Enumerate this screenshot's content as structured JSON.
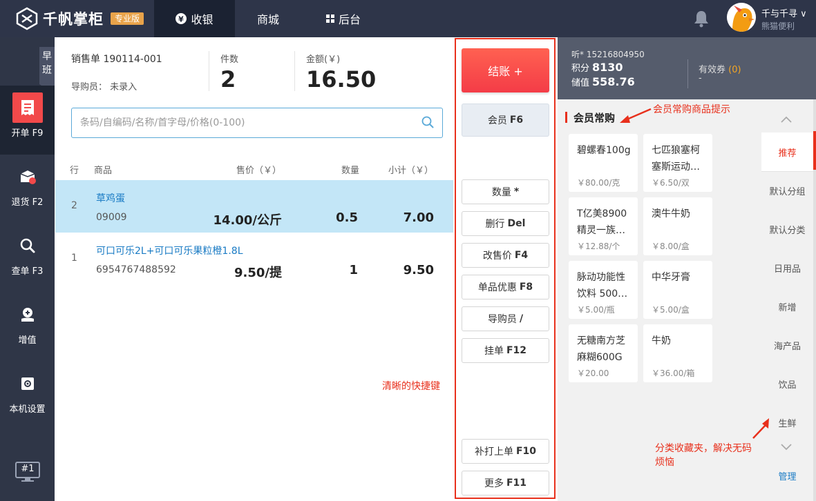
{
  "app": {
    "logo_text": "千帆掌柜",
    "edition": "专业版",
    "nav": [
      {
        "label": "收银",
        "active": true,
        "icon": "yen-circle-icon"
      },
      {
        "label": "商城",
        "active": false
      },
      {
        "label": "后台",
        "active": false,
        "icon": "grid-icon"
      }
    ],
    "user": {
      "name": "千与千寻",
      "store": "熊猫便利"
    }
  },
  "sidebar": {
    "shift": "早班",
    "items": [
      {
        "label": "开单 F9",
        "icon": "order-icon",
        "active": true
      },
      {
        "label": "退货 F2",
        "icon": "return-box-icon",
        "active": false
      },
      {
        "label": "查单 F3",
        "icon": "search-icon",
        "active": false
      },
      {
        "label": "增值",
        "icon": "value-added-icon",
        "active": false
      },
      {
        "label": "本机设置",
        "icon": "settings-icon",
        "active": false
      }
    ],
    "terminal": "#1"
  },
  "order": {
    "sales_no_label": "销售单 190114-001",
    "guide_label": "导购员： 未录入",
    "count_label": "件数",
    "count_value": "2",
    "amount_label": "金额(￥)",
    "amount_value": "16.50"
  },
  "search": {
    "placeholder": "条码/自编码/名称/首字母/价格(0-100)",
    "value": ""
  },
  "table": {
    "headers": {
      "row": "行",
      "product": "商品",
      "price": "售价（￥）",
      "qty": "数量",
      "subtotal": "小计（￥）"
    },
    "rows": [
      {
        "no": "2",
        "name": "草鸡蛋",
        "code": "09009",
        "price": "14.00/公斤",
        "qty": "0.5",
        "subtotal": "7.00",
        "selected": true
      },
      {
        "no": "1",
        "name": "可口可乐2L+可口可乐果粒橙1.8L",
        "code": "6954767488592",
        "price": "9.50/提",
        "qty": "1",
        "subtotal": "9.50",
        "selected": false
      }
    ]
  },
  "actions": {
    "checkout": "结账 +",
    "member": {
      "label": "会员",
      "key": "F6"
    },
    "buttons": [
      {
        "label": "数量",
        "key": "*"
      },
      {
        "label": "删行",
        "key": "Del"
      },
      {
        "label": "改售价",
        "key": "F4"
      },
      {
        "label": "单品优惠",
        "key": "F8"
      },
      {
        "label": "导购员",
        "key": "/"
      },
      {
        "label": "挂单",
        "key": "F12"
      }
    ],
    "bottom_buttons": [
      {
        "label": "补打上单",
        "key": "F10"
      },
      {
        "label": "更多",
        "key": "F11"
      }
    ]
  },
  "member_info": {
    "phone": "听* 15216804950",
    "points_label": "积分",
    "points": "8130",
    "stored_label": "储值",
    "stored": "558.76",
    "coupon_label": "有效券",
    "coupon_count": "(0)",
    "coupon_value": "-"
  },
  "frequent": {
    "title": "会员常购",
    "items": [
      {
        "name": "碧螺春100g",
        "price": "￥80.00/克"
      },
      {
        "name": "七匹狼塞柯塞斯运动…",
        "price": "￥6.50/双"
      },
      {
        "name": "T亿美8900精灵一族…",
        "price": "￥12.88/个"
      },
      {
        "name": "澳牛牛奶",
        "price": "￥8.00/盒"
      },
      {
        "name": "脉动功能性饮料 500…",
        "price": "￥5.00/瓶"
      },
      {
        "name": "中华牙膏",
        "price": "￥5.00/盒"
      },
      {
        "name": "无糖南方芝麻糊600G",
        "price": "￥20.00"
      },
      {
        "name": "牛奶",
        "price": "￥36.00/箱"
      }
    ]
  },
  "categories": {
    "items": [
      "推荐",
      "默认分组",
      "默认分类",
      "日用品",
      "新增",
      "海产品",
      "饮品",
      "生鲜"
    ],
    "active": "推荐",
    "manage": "管理"
  },
  "annotations": {
    "frequent_hint": "会员常购商品提示",
    "shortcut_hint": "清晰的快捷键",
    "category_hint": "分类收藏夹，解决无码烦恼"
  },
  "colors": {
    "topbar": "#2e3549",
    "sidebar": "#2f3647",
    "accent_red": "#f2494a",
    "selected_row": "#c3e6f7",
    "link_blue": "#1a7bc4",
    "coupon_orange": "#f5a623"
  }
}
